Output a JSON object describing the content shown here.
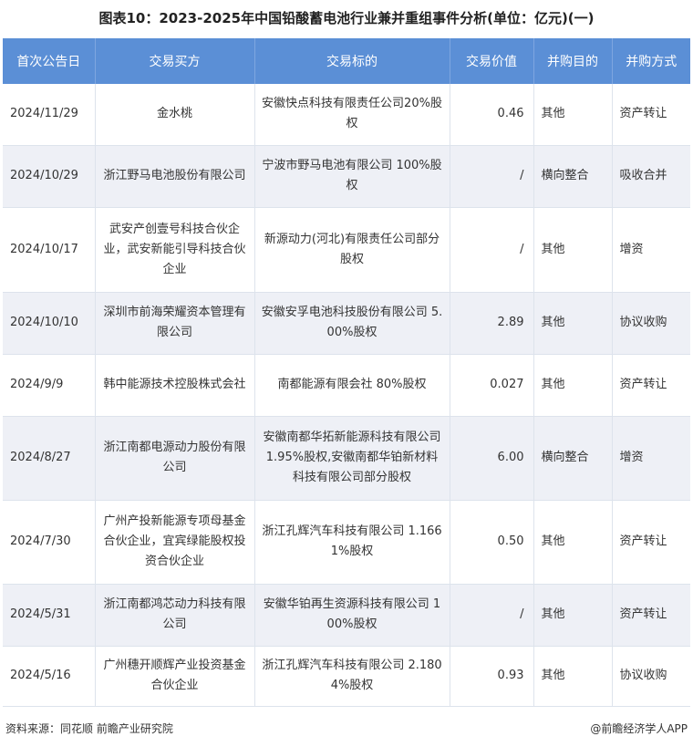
{
  "title": "图表10：2023-2025年中国铅酸蓄电池行业兼并重组事件分析(单位：亿元)(一)",
  "columns": [
    "首次公告日",
    "交易买方",
    "交易标的",
    "交易价值",
    "并购目的",
    "并购方式"
  ],
  "rows": [
    {
      "date": "2024/11/29",
      "buyer": "金水桃",
      "target": "安徽快点科技有限责任公司20%股权",
      "value": "0.46",
      "purpose": "其他",
      "method": "资产转让"
    },
    {
      "date": "2024/10/29",
      "buyer": "浙江野马电池股份有限公司",
      "target": "宁波市野马电池有限公司 100%股权",
      "value": "/",
      "purpose": "横向整合",
      "method": "吸收合并"
    },
    {
      "date": "2024/10/17",
      "buyer": "武安产创壹号科技合伙企业，武安新能引导科技合伙企业",
      "target": "新源动力(河北)有限责任公司部分股权",
      "value": "/",
      "purpose": "其他",
      "method": "增资"
    },
    {
      "date": "2024/10/10",
      "buyer": "深圳市前海荣耀资本管理有限公司",
      "target": "安徽安孚电池科技股份有限公司 5.00%股权",
      "value": "2.89",
      "purpose": "其他",
      "method": "协议收购"
    },
    {
      "date": "2024/9/9",
      "buyer": "韩中能源技术控股株式会社",
      "target": "南都能源有限会社 80%股权",
      "value": "0.027",
      "purpose": "其他",
      "method": "资产转让"
    },
    {
      "date": "2024/8/27",
      "buyer": "浙江南都电源动力股份有限公司",
      "target": "安徽南都华拓新能源科技有限公司 1.95%股权,安徽南都华铂新材料科技有限公司部分股权",
      "value": "6.00",
      "purpose": "横向整合",
      "method": "增资"
    },
    {
      "date": "2024/7/30",
      "buyer": "广州产投新能源专项母基金合伙企业，宜宾绿能股权投资合伙企业",
      "target": "浙江孔辉汽车科技有限公司 1.1661%股权",
      "value": "0.50",
      "purpose": "其他",
      "method": "资产转让"
    },
    {
      "date": "2024/5/31",
      "buyer": "浙江南都鸿芯动力科技有限公司",
      "target": "安徽华铂再生资源科技有限公司 100%股权",
      "value": "/",
      "purpose": "其他",
      "method": "资产转让"
    },
    {
      "date": "2024/5/16",
      "buyer": "广州穗开顺辉产业投资基金合伙企业",
      "target": "浙江孔辉汽车科技有限公司 2.1804%股权",
      "value": "0.93",
      "purpose": "其他",
      "method": "协议收购"
    }
  ],
  "footer": {
    "source": "资料来源：同花顺 前瞻产业研究院",
    "brand": "@前瞻经济学人APP"
  }
}
